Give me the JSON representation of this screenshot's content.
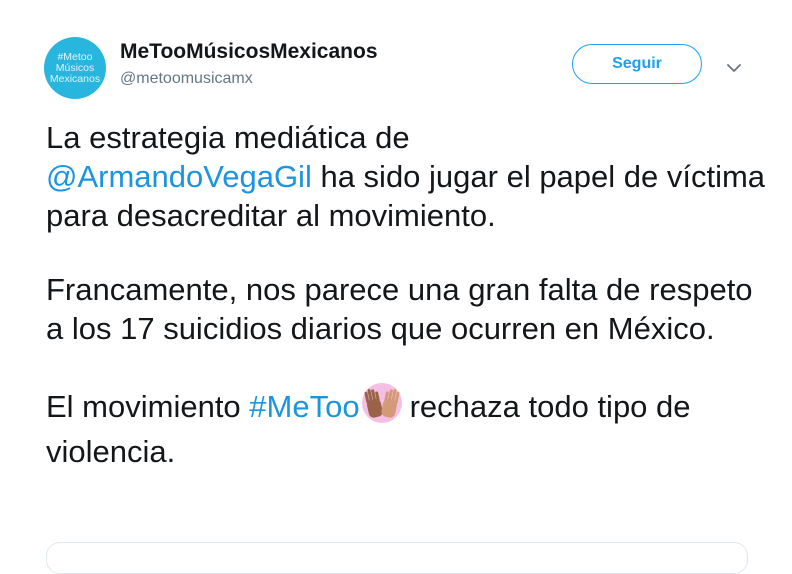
{
  "profile": {
    "avatar_lines": [
      "#Metoo",
      "Músicos",
      "Mexicanos"
    ],
    "display_name": "MeTooMúsicosMexicanos",
    "handle": "@metoomusicamx"
  },
  "actions": {
    "follow_label": "Seguir",
    "more_icon": "chevron-down-icon"
  },
  "tweet": {
    "p1_text_1": "La estrategia mediática de",
    "p1_mention": "@ArmandoVegaGil",
    "p1_text_2": " ha sido jugar el papel de víctima para desacreditar al movimiento.",
    "p2_text": "Francamente, nos parece una gran falta de respeto a los 17 suicidios diarios que ocurren en México.",
    "p3_text_1": "El movimiento ",
    "p3_hashtag": "#MeToo",
    "p3_emoji": "raised-hands-icon",
    "p3_text_2": "rechaza todo tipo de violencia."
  },
  "colors": {
    "accent": "#1da1f2",
    "link": "#1b95e0",
    "avatar_bg": "#28b6de",
    "text": "#14171a",
    "secondary": "#657786"
  }
}
